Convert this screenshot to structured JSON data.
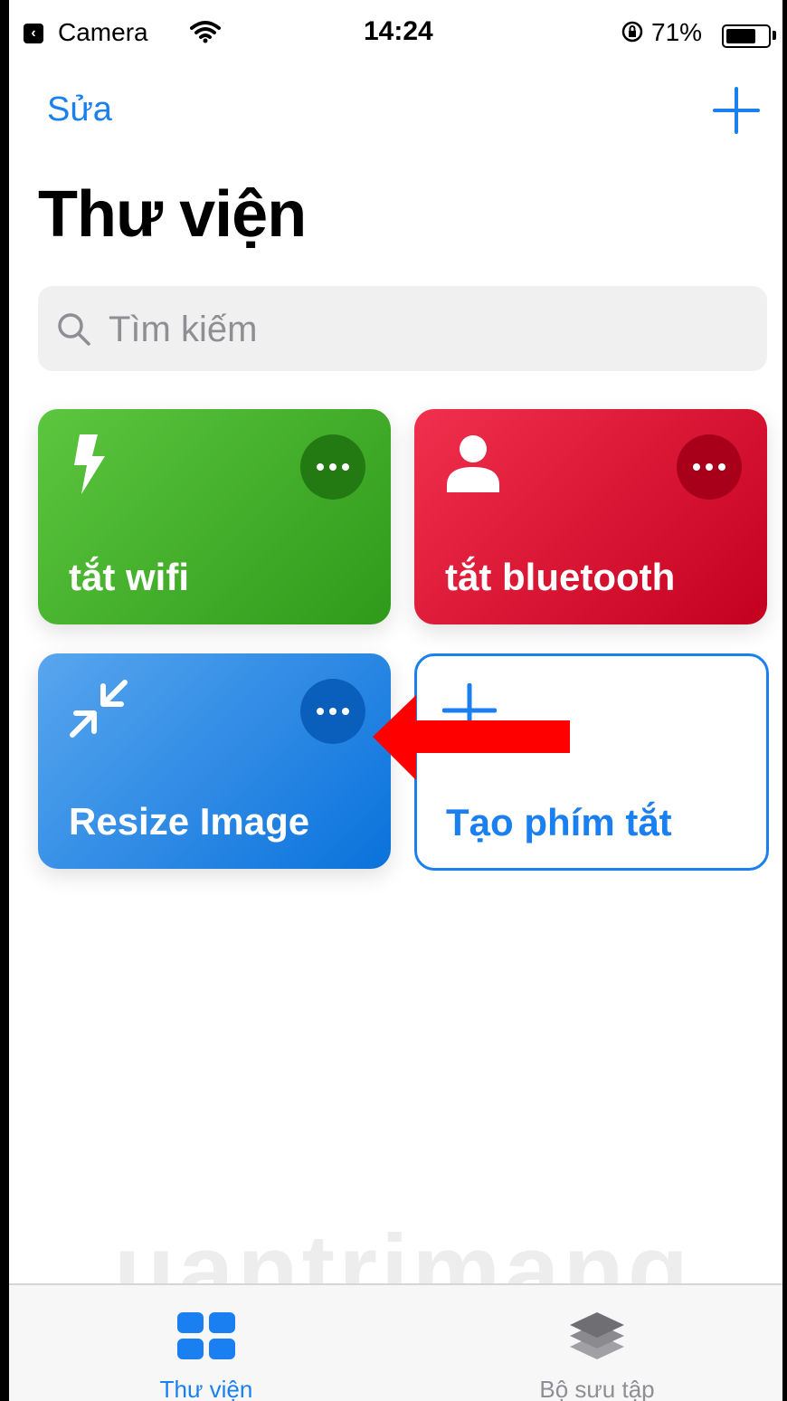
{
  "status_bar": {
    "back_app": "Camera",
    "time": "14:24",
    "battery": "71%",
    "battery_level": 0.71
  },
  "nav": {
    "edit_label": "Sửa"
  },
  "page": {
    "title": "Thư viện"
  },
  "search": {
    "placeholder": "Tìm kiếm"
  },
  "shortcuts": [
    {
      "label": "tắt wifi",
      "icon": "bolt-icon",
      "color": "#3fab27"
    },
    {
      "label": "tắt bluetooth",
      "icon": "person-icon",
      "color": "#dc1535"
    },
    {
      "label": "Resize Image",
      "icon": "arrows-in-icon",
      "color": "#2f8ae6"
    }
  ],
  "create_shortcut": {
    "label": "Tạo phím tắt"
  },
  "annotation": {
    "arrow_color": "#ff0000"
  },
  "watermark": {
    "text": "uantrimang"
  },
  "tabbar": {
    "tabs": [
      {
        "label": "Thư viện",
        "icon": "grid-icon",
        "active": true
      },
      {
        "label": "Bộ sưu tập",
        "icon": "layers-icon",
        "active": false
      }
    ]
  },
  "colors": {
    "accent": "#1a7ff0"
  }
}
